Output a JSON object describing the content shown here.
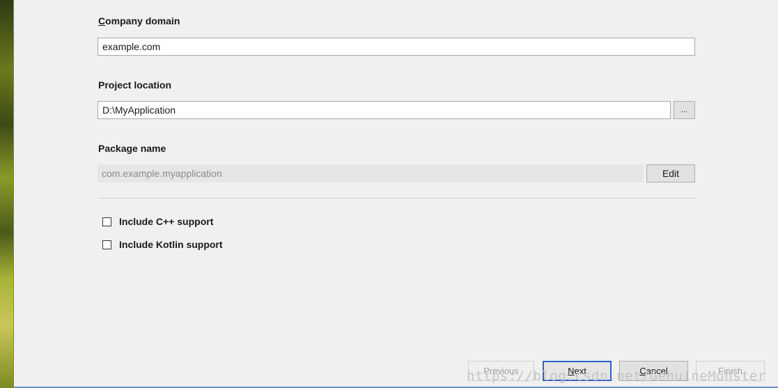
{
  "form": {
    "company_domain_label": "Company domain",
    "company_domain_label_mnemonic": "C",
    "company_domain_label_rest": "ompany domain",
    "company_domain_value": "example.com",
    "project_location_label": "Project location",
    "project_location_value": "D:\\MyApplication",
    "browse_label": "...",
    "package_name_label": "Package name",
    "package_name_value": "com.example.myapplication",
    "edit_label": "Edit",
    "cpp_support_label": "Include C++ support",
    "kotlin_support_label": "Include Kotlin support"
  },
  "footer": {
    "previous_label": "Previous",
    "next_label": "Next",
    "next_mnemonic": "N",
    "next_rest": "ext",
    "cancel_label": "Cancel",
    "cancel_mnemonic": "C",
    "cancel_rest": "ancel",
    "finish_label": "Finish"
  },
  "watermark": "https://blog.csdn.net/GenuineMonster",
  "colors": {
    "dialog_bg": "#f0f0f0",
    "primary_button_border": "#2b63c6",
    "disabled_text": "#a0a0a0"
  }
}
